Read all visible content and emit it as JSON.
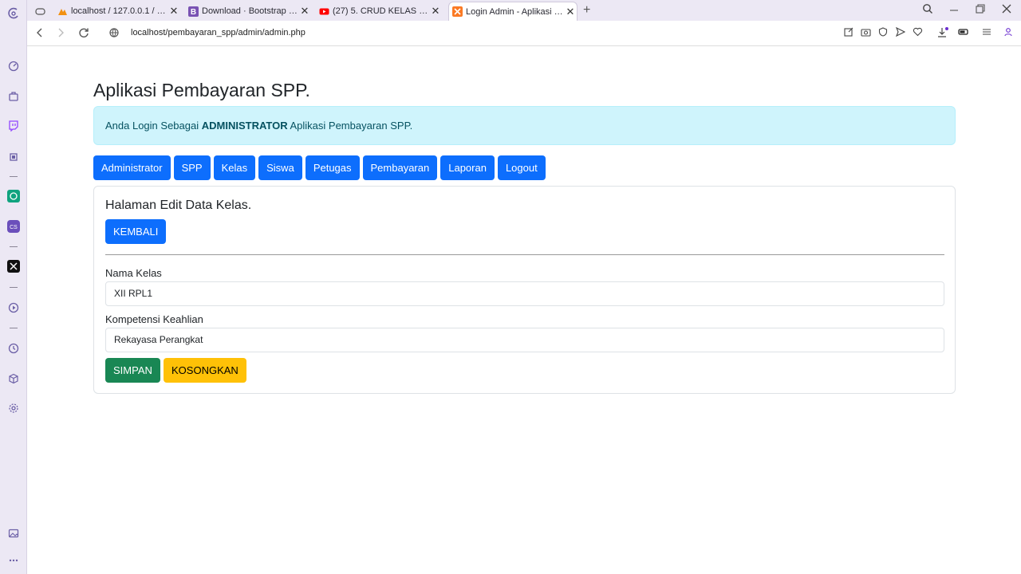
{
  "browser": {
    "tabs": [
      {
        "title": "localhost / 127.0.0.1 / db_s",
        "close": "✕"
      },
      {
        "title": "Download · Bootstrap v5.3",
        "close": "✕"
      },
      {
        "title": "(27) 5. CRUD KELAS - APLI",
        "close": "✕"
      },
      {
        "title": "Login Admin - Aplikasi Pem",
        "close": "✕"
      }
    ],
    "url": "localhost/pembayaran_spp/admin/admin.php"
  },
  "page": {
    "app_title": "Aplikasi Pembayaran SPP.",
    "alert": {
      "prefix": "Anda Login Sebagai",
      "role": "ADMINISTRATOR",
      "suffix": "Aplikasi Pembayaran SPP."
    },
    "nav": [
      "Administrator",
      "SPP",
      "Kelas",
      "Siswa",
      "Petugas",
      "Pembayaran",
      "Laporan",
      "Logout"
    ],
    "card": {
      "title": "Halaman Edit Data Kelas.",
      "back_label": "KEMBALI",
      "field1_label": "Nama Kelas",
      "field1_value": "XII RPL1",
      "field2_label": "Kompetensi Keahlian",
      "field2_value": "Rekayasa Perangkat",
      "save_label": "SIMPAN",
      "clear_label": "KOSONGKAN"
    }
  },
  "colors": {
    "primary": "#0d6efd",
    "success": "#198754",
    "warning": "#ffc107",
    "info_bg": "#cff4fc"
  }
}
